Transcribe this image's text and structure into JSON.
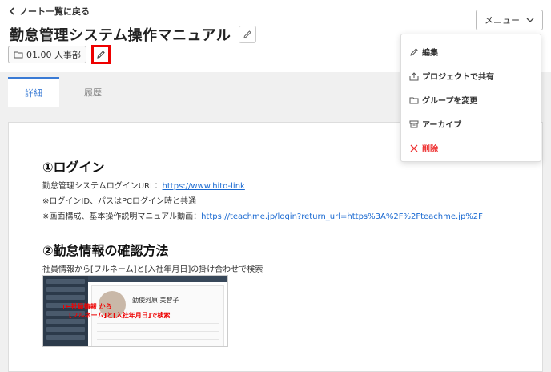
{
  "nav": {
    "back_label": "ノート一覧に戻る"
  },
  "header": {
    "title": "勤怠管理システム操作マニュアル",
    "folder_label": "01.00 人事部",
    "menu_label": "メニュー"
  },
  "tabs": [
    {
      "label": "詳細",
      "active": true
    },
    {
      "label": "履歴",
      "active": false
    }
  ],
  "dropdown": {
    "items": [
      {
        "label": "編集",
        "icon": "pencil-icon",
        "danger": false
      },
      {
        "label": "プロジェクトで共有",
        "icon": "share-icon",
        "danger": false
      },
      {
        "label": "グループを変更",
        "icon": "folder-icon",
        "danger": false
      },
      {
        "label": "アーカイブ",
        "icon": "archive-icon",
        "danger": false
      },
      {
        "label": "削除",
        "icon": "close-icon",
        "danger": true
      }
    ]
  },
  "content": {
    "section1": {
      "heading": "①ログイン",
      "line1_prefix": "勤怠管理システムログインURL：",
      "line1_link": "https://www.hito-link",
      "line2": "※ログインID、パスはPCログイン時と共通",
      "line3_prefix": "※画面構成、基本操作説明マニュアル動画：",
      "line3_link": "https://teachme.jp/login?return_url=https%3A%2F%2Fteachme.jp%2F"
    },
    "section2": {
      "heading": "②勤怠情報の確認方法",
      "line1": "社員情報から[フルネーム]と[入社年月日]の掛け合わせで検索"
    },
    "screenshot": {
      "person_name": "勤使河原 美智子",
      "annot_line1": "←社員情報 から",
      "annot_line2": "[フルネーム]と[入社年月日]で検索"
    }
  },
  "colors": {
    "accent": "#3a7bd5",
    "danger": "#e33333",
    "highlight": "#e00000"
  }
}
